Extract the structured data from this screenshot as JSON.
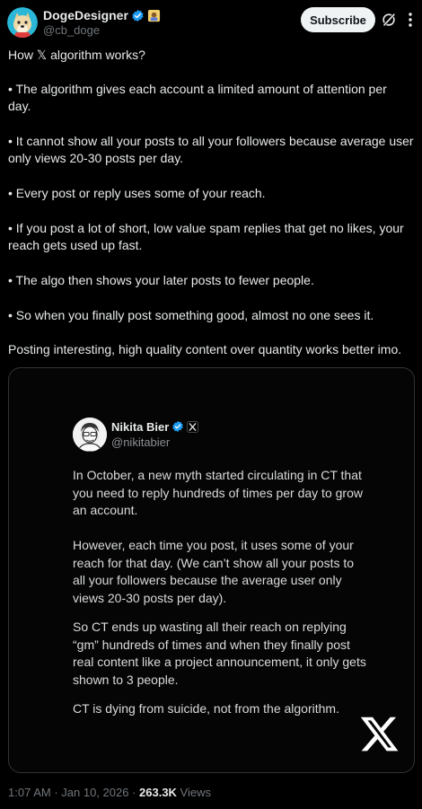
{
  "author": {
    "name": "DogeDesigner",
    "handle": "@cb_doge",
    "verified": true,
    "badge_color": "#1d9bf0"
  },
  "header": {
    "subscribe_label": "Subscribe",
    "icons": [
      "grok-icon",
      "more-vertical-icon"
    ]
  },
  "post": {
    "paragraphs": [
      "How 𝕏 algorithm works?",
      "• The algorithm gives each account a limited amount of attention per day.",
      "• It cannot show all your posts to all your followers because average user only views 20-30 posts per day.",
      "• Every post or reply uses some of your reach.",
      "• If you post a lot of short, low value spam replies that get no likes, your reach gets used up fast.",
      "• The algo then shows your later posts to fewer people.",
      "• So when you finally post something good, almost no one sees it.",
      "Posting interesting, high quality content over quantity works better imo."
    ]
  },
  "embedded": {
    "author_name": "Nikita Bier",
    "author_handle": "@nikitabier",
    "paragraphs": [
      "In October, a new myth started circulating in CT that you need to reply hundreds of times per day to grow an account.",
      "However, each time you post, it uses some of your reach for that day. (We can’t show all your posts to all your followers because the average user only views 20-30 posts per day).",
      "So CT ends up wasting all their reach on replying “gm” hundreds of times and when they finally post real content like a project announcement, it only gets shown to 3 people.",
      "CT is dying from suicide, not from the algorithm."
    ]
  },
  "meta": {
    "time": "1:07 AM",
    "separator": " · ",
    "date": "Jan 10, 2026",
    "views_count": "263.3K",
    "views_label": " Views"
  },
  "colors": {
    "background": "#000000",
    "text": "#e7e9ea",
    "muted": "#71767b",
    "verified": "#1d9bf0",
    "border": "#2f3336"
  }
}
